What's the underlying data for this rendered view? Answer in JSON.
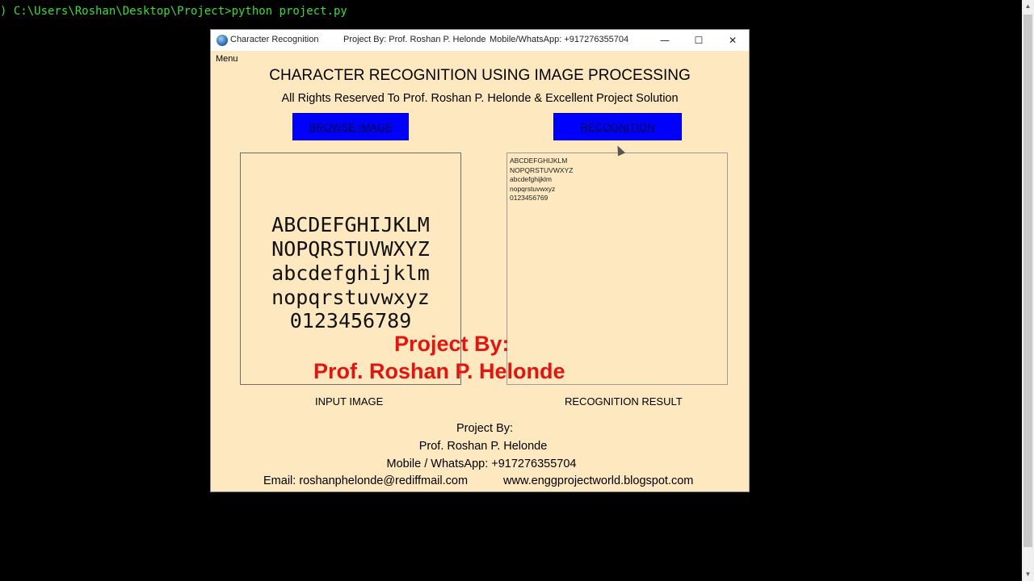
{
  "console": {
    "command_line": ") C:\\Users\\Roshan\\Desktop\\Project>python project.py"
  },
  "window": {
    "title": "Character Recognition",
    "project_by": "Project By: Prof. Roshan P. Helonde",
    "contact": "Mobile/WhatsApp: +917276355704",
    "controls": {
      "minimize": "—",
      "maximize": "☐",
      "close": "✕"
    },
    "menu": {
      "label": "Menu"
    }
  },
  "app": {
    "heading": "CHARACTER RECOGNITION USING IMAGE PROCESSING",
    "subheading": "All Rights Reserved To Prof. Roshan P. Helonde & Excellent Project Solution",
    "browse_button": "BROWSE IMAGE",
    "recognition_button": "RECOGNITION",
    "input_image_lines": [
      "ABCDEFGHIJKLM",
      "NOPQRSTUVWXYZ",
      "abcdefghijklm",
      "nopqrstuvwxyz",
      "0123456789"
    ],
    "result_lines": [
      "ABCDEFGHIJKLM",
      "NOPQRSTUVWXYZ",
      "abcdefghijklm",
      "nopqrstuvwxyz",
      "0123456769"
    ],
    "input_label": "INPUT IMAGE",
    "result_label": "RECOGNITION RESULT",
    "watermark_line1": "Project By:",
    "watermark_line2": "Prof. Roshan P. Helonde",
    "footer": {
      "line1": "Project By:",
      "line2": "Prof. Roshan P. Helonde",
      "line3": "Mobile / WhatsApp: +917276355704",
      "email": "Email: roshanphelonde@rediffmail.com",
      "website": "www.enggprojectworld.blogspot.com"
    }
  },
  "colors": {
    "window_bg": "#fde8c0",
    "button_blue": "#0000ff",
    "watermark_red": "#e3150f",
    "console_green": "#3fdc3f"
  }
}
